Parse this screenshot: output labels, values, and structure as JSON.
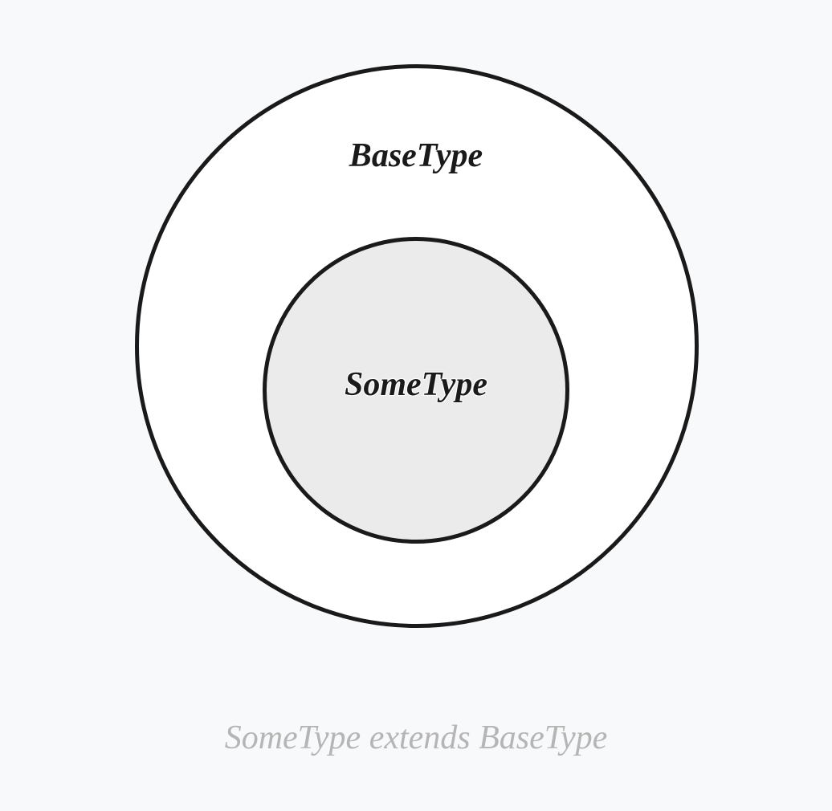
{
  "diagram": {
    "outer_label": "BaseType",
    "inner_label": "SomeType",
    "caption": "SomeType extends BaseType"
  }
}
